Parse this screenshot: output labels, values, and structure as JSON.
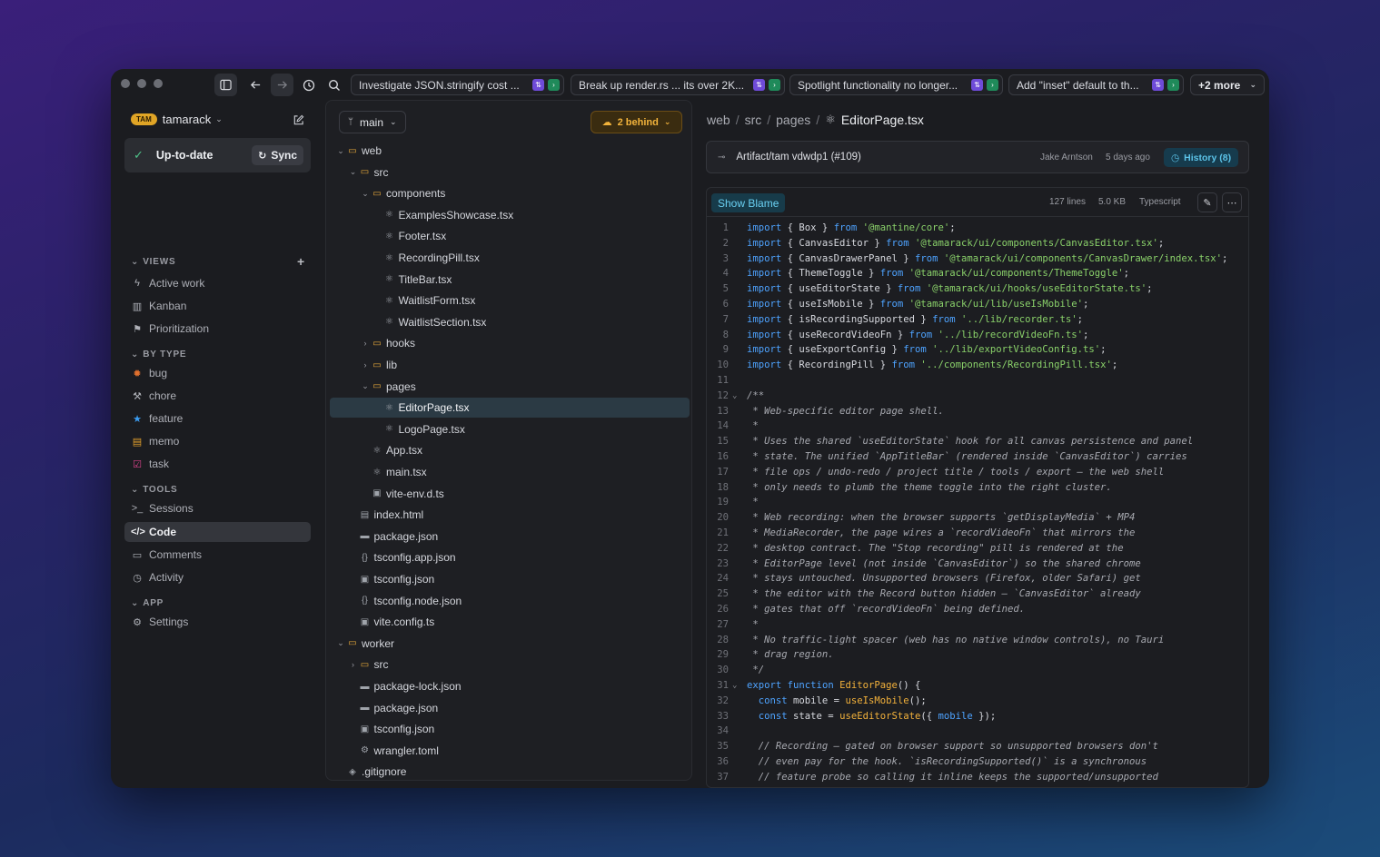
{
  "topbar": {
    "tabs": [
      {
        "label": "Investigate JSON.stringify cost ..."
      },
      {
        "label": "Break up render.rs ... its over 2K..."
      },
      {
        "label": "Spotlight functionality no longer..."
      },
      {
        "label": "Add \"inset\" default to th..."
      }
    ],
    "more_label": "+2 more"
  },
  "sidebar": {
    "workspace_badge": "TAM",
    "workspace_name": "tamarack",
    "status_label": "Up-to-date",
    "sync_label": "Sync",
    "sections": {
      "views": "VIEWS",
      "by_type": "BY TYPE",
      "tools": "TOOLS",
      "app": "APP"
    },
    "views": [
      "Active work",
      "Kanban",
      "Prioritization"
    ],
    "types": [
      "bug",
      "chore",
      "feature",
      "memo",
      "task"
    ],
    "tools": [
      "Sessions",
      "Code",
      "Comments",
      "Activity"
    ],
    "app": [
      "Settings"
    ]
  },
  "tree": {
    "branch": "main",
    "behind_label": "2 behind",
    "items": [
      {
        "name": "web",
        "depth": 0,
        "kind": "folder",
        "open": true
      },
      {
        "name": "src",
        "depth": 1,
        "kind": "folder",
        "open": true
      },
      {
        "name": "components",
        "depth": 2,
        "kind": "folder",
        "open": true
      },
      {
        "name": "ExamplesShowcase.tsx",
        "depth": 3,
        "kind": "react"
      },
      {
        "name": "Footer.tsx",
        "depth": 3,
        "kind": "react"
      },
      {
        "name": "RecordingPill.tsx",
        "depth": 3,
        "kind": "react"
      },
      {
        "name": "TitleBar.tsx",
        "depth": 3,
        "kind": "react"
      },
      {
        "name": "WaitlistForm.tsx",
        "depth": 3,
        "kind": "react"
      },
      {
        "name": "WaitlistSection.tsx",
        "depth": 3,
        "kind": "react"
      },
      {
        "name": "hooks",
        "depth": 2,
        "kind": "folder",
        "open": false
      },
      {
        "name": "lib",
        "depth": 2,
        "kind": "folder",
        "open": false
      },
      {
        "name": "pages",
        "depth": 2,
        "kind": "folder",
        "open": true
      },
      {
        "name": "EditorPage.tsx",
        "depth": 3,
        "kind": "react",
        "selected": true
      },
      {
        "name": "LogoPage.tsx",
        "depth": 3,
        "kind": "react"
      },
      {
        "name": "App.tsx",
        "depth": 2,
        "kind": "react"
      },
      {
        "name": "main.tsx",
        "depth": 2,
        "kind": "react"
      },
      {
        "name": "vite-env.d.ts",
        "depth": 2,
        "kind": "ts"
      },
      {
        "name": "index.html",
        "depth": 1,
        "kind": "html"
      },
      {
        "name": "package.json",
        "depth": 1,
        "kind": "npm"
      },
      {
        "name": "tsconfig.app.json",
        "depth": 1,
        "kind": "json"
      },
      {
        "name": "tsconfig.json",
        "depth": 1,
        "kind": "ts"
      },
      {
        "name": "tsconfig.node.json",
        "depth": 1,
        "kind": "json"
      },
      {
        "name": "vite.config.ts",
        "depth": 1,
        "kind": "ts"
      },
      {
        "name": "worker",
        "depth": 0,
        "kind": "folder",
        "open": true
      },
      {
        "name": "src",
        "depth": 1,
        "kind": "folder",
        "open": false
      },
      {
        "name": "package-lock.json",
        "depth": 1,
        "kind": "npm"
      },
      {
        "name": "package.json",
        "depth": 1,
        "kind": "npm"
      },
      {
        "name": "tsconfig.json",
        "depth": 1,
        "kind": "ts"
      },
      {
        "name": "wrangler.toml",
        "depth": 1,
        "kind": "gear"
      },
      {
        "name": ".gitignore",
        "depth": 0,
        "kind": "git"
      }
    ]
  },
  "editor": {
    "breadcrumb": [
      "web",
      "src",
      "pages",
      "EditorPage.tsx"
    ],
    "commit_message": "Artifact/tam vdwdp1 (#109)",
    "commit_author": "Jake Arntson",
    "commit_ago": "5 days ago",
    "history_label": "History (8)",
    "blame_label": "Show Blame",
    "lines_count": "127 lines",
    "file_size": "5.0 KB",
    "language": "Typescript"
  }
}
